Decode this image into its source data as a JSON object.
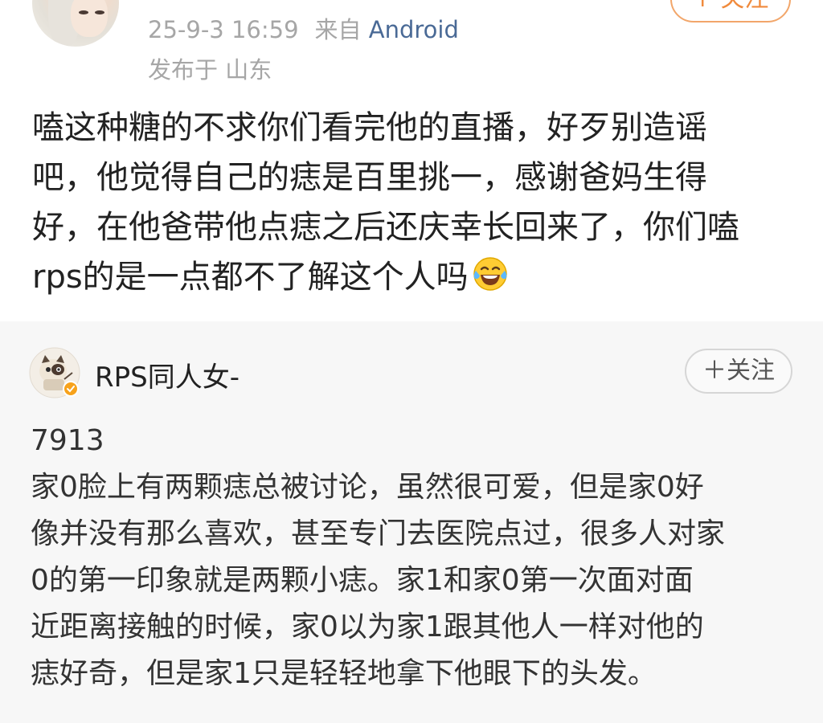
{
  "post": {
    "timestamp": "25-9-3 16:59",
    "source_prefix": "来自",
    "source_device": "Android",
    "location": "发布于 山东",
    "follow_label": "+ 关注",
    "content_lines": [
      "嗑这种糖的不求你们看完他的直播，好歹别造谣",
      "吧，他觉得自己的痣是百里挑一，感谢爸妈生得",
      "好，在他爸带他点痣之后还庆幸长回来了，你们嗑",
      "rps的是一点都不了解这个人吗"
    ],
    "emoji_icon": "laughing-tears-emoji"
  },
  "repost": {
    "author_name": "RPS同人女-",
    "follow_label": "＋关注",
    "verified_badge_icon": "verified-badge-icon",
    "content_lines": [
      "7913",
      "家0脸上有两颗痣总被讨论，虽然很可爱，但是家0好",
      "像并没有那么喜欢，甚至专门去医院点过，很多人对家",
      "0的第一印象就是两颗小痣。家1和家0第一次面对面",
      "近距离接触的时候，家0以为家1跟其他人一样对他的",
      "痣好奇，但是家1只是轻轻地拿下他眼下的头发。"
    ]
  },
  "colors": {
    "meta_gray": "#a6a6a6",
    "device_blue": "#4a6a96",
    "follow_orange": "#f08a3c",
    "repost_bg": "#f7f7f7",
    "text_dark": "#222222"
  }
}
